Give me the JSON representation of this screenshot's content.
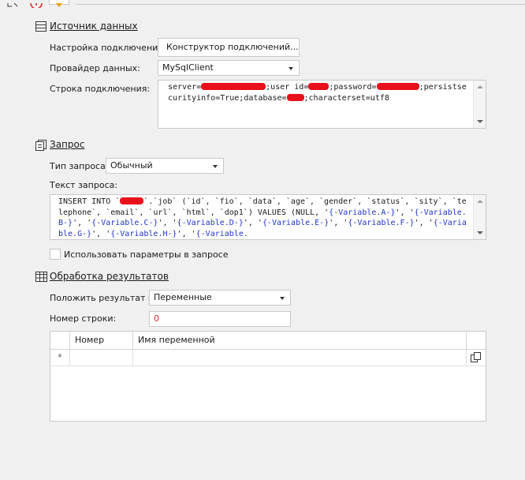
{
  "sections": {
    "datasource": {
      "title": "Источник данных"
    },
    "query": {
      "title": "Запрос"
    },
    "results": {
      "title": "Обработка результатов"
    }
  },
  "connection": {
    "settings_label": "Настройка подключения:",
    "builder_button": "Конструктор подключений...",
    "provider_label": "Провайдер данных:",
    "provider_value": "MySqlClient",
    "string_label": "Строка подключения:",
    "string_parts": {
      "p1": "server=",
      "p2": ";user id=",
      "p3": ";password=",
      "p4": ";persis",
      "p5": "tsecurityinfo=True;database=",
      "p6": ";characterset=utf8"
    }
  },
  "query": {
    "type_label": "Тип запроса:",
    "type_value": "Обычный",
    "text_label": "Текст запроса:",
    "sql": {
      "s1": "INSERT INTO `",
      "s2": "`.`job` (`id`, `fio`, `data`, `age`, `gender`, `status`, `",
      "s3": "sity`, `telephone`, `email`, `url`, `html`, `dop1`) VALUES (NULL, '",
      "v1": "{-Varia",
      "v2": "ble.A-}",
      "s4": "', '",
      "v3": "{-Variable.B-}",
      "s5": "', '",
      "v4": "{-Variable.C-}",
      "s6": "', '",
      "v5": "{-Variable.D-}",
      "s7": "', '",
      "v6": "{-Variabl",
      "v7": "e.E-}",
      "s8": "', '",
      "v8": "{-Variable.F-}",
      "s9": "', '",
      "v9": "{-Variable.G-}",
      "s10": "', '",
      "v10": "{-Variable.H-}",
      "s11": "', '",
      "v11": "{-Variable."
    },
    "use_params_label": "Использовать параметры в запросе",
    "use_params_checked": false
  },
  "results": {
    "put_result_label": "Положить результат в:",
    "put_result_value": "Переменные",
    "row_number_label": "Номер строки:",
    "row_number_value": "0",
    "grid": {
      "columns": [
        "Номер",
        "Имя переменной"
      ],
      "new_row_marker": "*"
    }
  },
  "colors": {
    "redaction": "#e8101a",
    "variable_text": "#1f35c8",
    "background": "#f0f0f0"
  }
}
